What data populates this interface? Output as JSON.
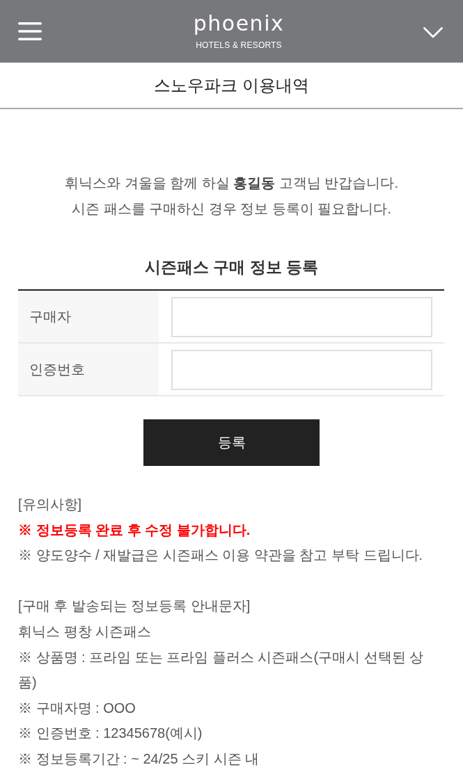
{
  "header": {
    "logo": {
      "name": "phoenix",
      "tagline": "HOTELS & RESORTS"
    }
  },
  "page_title": "스노우파크 이용내역",
  "greeting": [
    "휘닉스와 겨울을 함께 하실 **홍길동** 고객님 반갑습니다.",
    "시즌 패스를 구매하신 경우 정보 등록이 필요합니다."
  ],
  "form": {
    "title": "시즌패스 구매 정보 등록",
    "fields": [
      {
        "label": "구매자"
      },
      {
        "label": "인증번호"
      }
    ],
    "submit": "등록"
  },
  "notes": [
    {
      "heading": "[유의사항]",
      "lines": [
        {
          "kind": "warning",
          "text": "※ 정보등록 완료 후 수정 불가합니다."
        },
        {
          "kind": "note",
          "text": "※ 양도양수 / 재발급은 시즌패스 이용 약관을 참고 부탁 드립니다."
        }
      ]
    },
    {
      "heading": "[구매 후 발송되는 정보등록 안내문자]",
      "lines": [
        {
          "kind": "note",
          "text": "휘닉스 평창 시즌패스"
        },
        {
          "kind": "note",
          "text": "※ 상품명 : 프라임 또는 프라임 플러스 시즌패스(구매시 선택된 상품)"
        },
        {
          "kind": "note",
          "text": "※ 구매자명 : OOO"
        },
        {
          "kind": "note",
          "text": "※ 인증번호 : 12345678(예시)"
        },
        {
          "kind": "note",
          "text": "※ 정보등록기간 : ~ 24/25 스키 시즌 내"
        }
      ]
    }
  ]
}
